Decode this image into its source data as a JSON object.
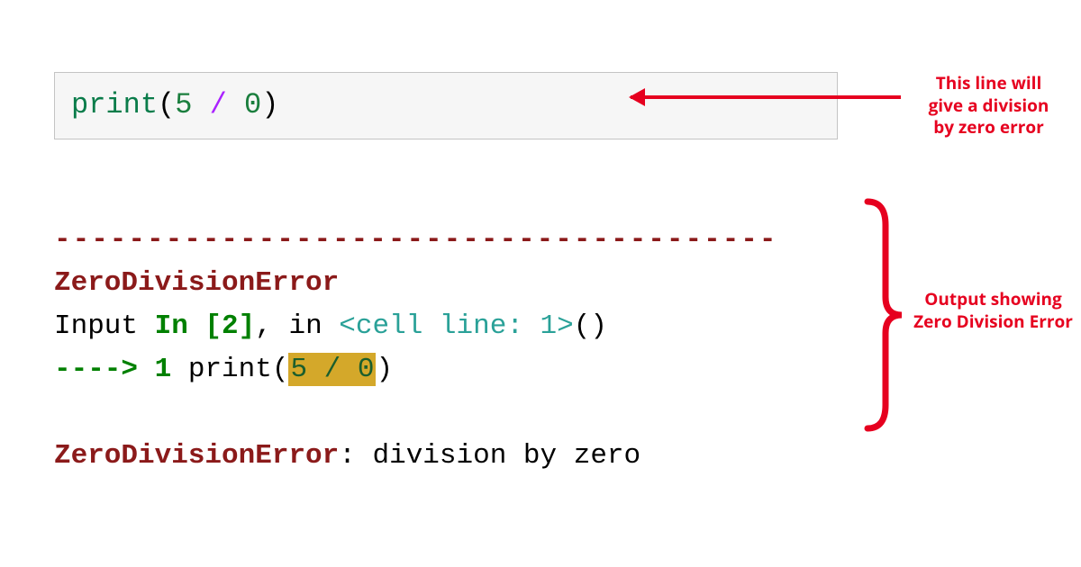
{
  "code": {
    "func": "print",
    "lparen": "(",
    "arg1": "5",
    "op": " / ",
    "arg2": "0",
    "rparen": ")"
  },
  "output": {
    "dashes": "---------------------------------------",
    "err_name": "ZeroDivisionError",
    "input_label": "Input ",
    "in_literal": "In [",
    "in_num": "2",
    "in_close": "]",
    "comma": ", ",
    "in_word": "in ",
    "cell_ref": "<cell line: 1>",
    "parens": "()",
    "arrow": "----> ",
    "lineno": "1 ",
    "call": "print(",
    "hl_expr": "5 / 0",
    "call_close": ")",
    "final_err": "ZeroDivisionError",
    "colon": ": ",
    "msg": "division by zero"
  },
  "annotations": {
    "a1_line1": "This line will",
    "a1_line2": "give a division",
    "a1_line3": "by zero error",
    "a2_line1": "Output showing",
    "a2_line2": "Zero Division Error"
  }
}
